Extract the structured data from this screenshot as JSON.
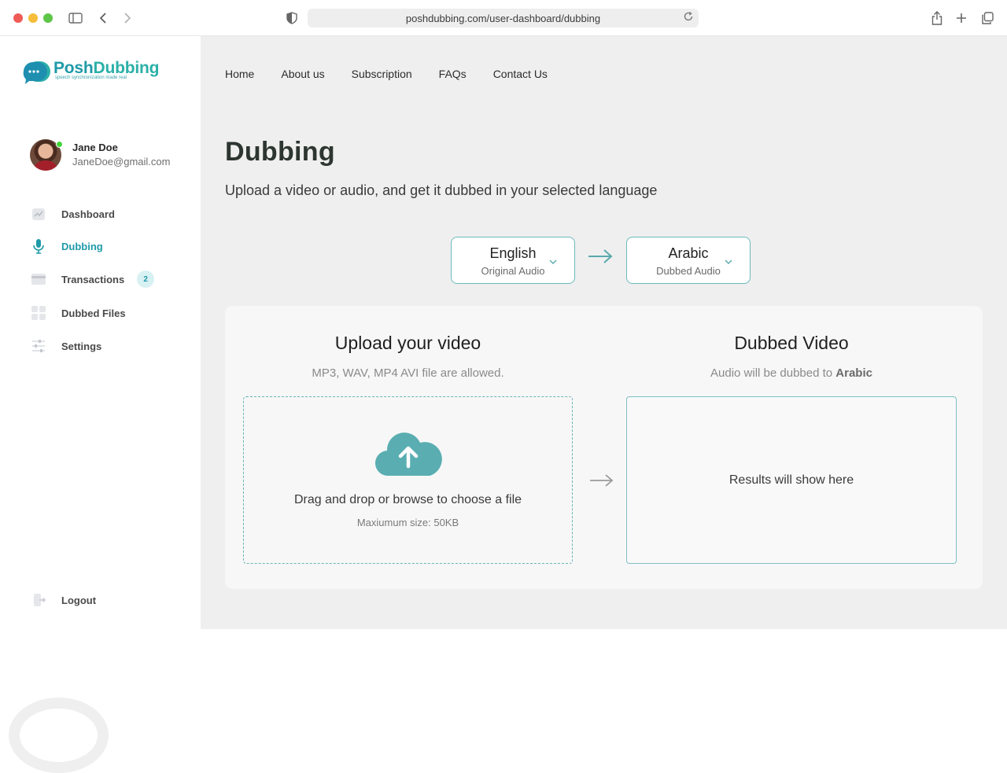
{
  "browser": {
    "url": "poshdubbing.com/user-dashboard/dubbing"
  },
  "brand": {
    "name_part1": "Posh",
    "name_part2": "Dubbing",
    "tagline": "speech synchronization made real",
    "accent_color": "#1f9aa8"
  },
  "user": {
    "name": "Jane Doe",
    "email": "JaneDoe@gmail.com",
    "status": "online"
  },
  "sidebar": {
    "items": [
      {
        "label": "Dashboard",
        "icon": "chart-icon",
        "active": false
      },
      {
        "label": "Dubbing",
        "icon": "microphone-icon",
        "active": true
      },
      {
        "label": "Transactions",
        "icon": "card-icon",
        "active": false,
        "badge": "2"
      },
      {
        "label": "Dubbed Files",
        "icon": "grid-icon",
        "active": false
      },
      {
        "label": "Settings",
        "icon": "sliders-icon",
        "active": false
      }
    ],
    "logout_label": "Logout"
  },
  "topnav": [
    "Home",
    "About us",
    "Subscription",
    "FAQs",
    "Contact Us"
  ],
  "page": {
    "title": "Dubbing",
    "subtitle": "Upload a video or audio, and get it dubbed in your selected language"
  },
  "languages": {
    "source": {
      "name": "English",
      "sub": "Original Audio"
    },
    "target": {
      "name": "Arabic",
      "sub": "Dubbed Audio"
    }
  },
  "upload": {
    "title": "Upload your video",
    "formats": "MP3, WAV, MP4 AVI file are allowed.",
    "drop_text": "Drag and drop or browse to choose a file",
    "max_size": "Maxiumum size: 50KB"
  },
  "dubbed": {
    "title": "Dubbed Video",
    "sub_prefix": "Audio will be dubbed to",
    "sub_lang": "Arabic",
    "placeholder": "Results will show here"
  }
}
